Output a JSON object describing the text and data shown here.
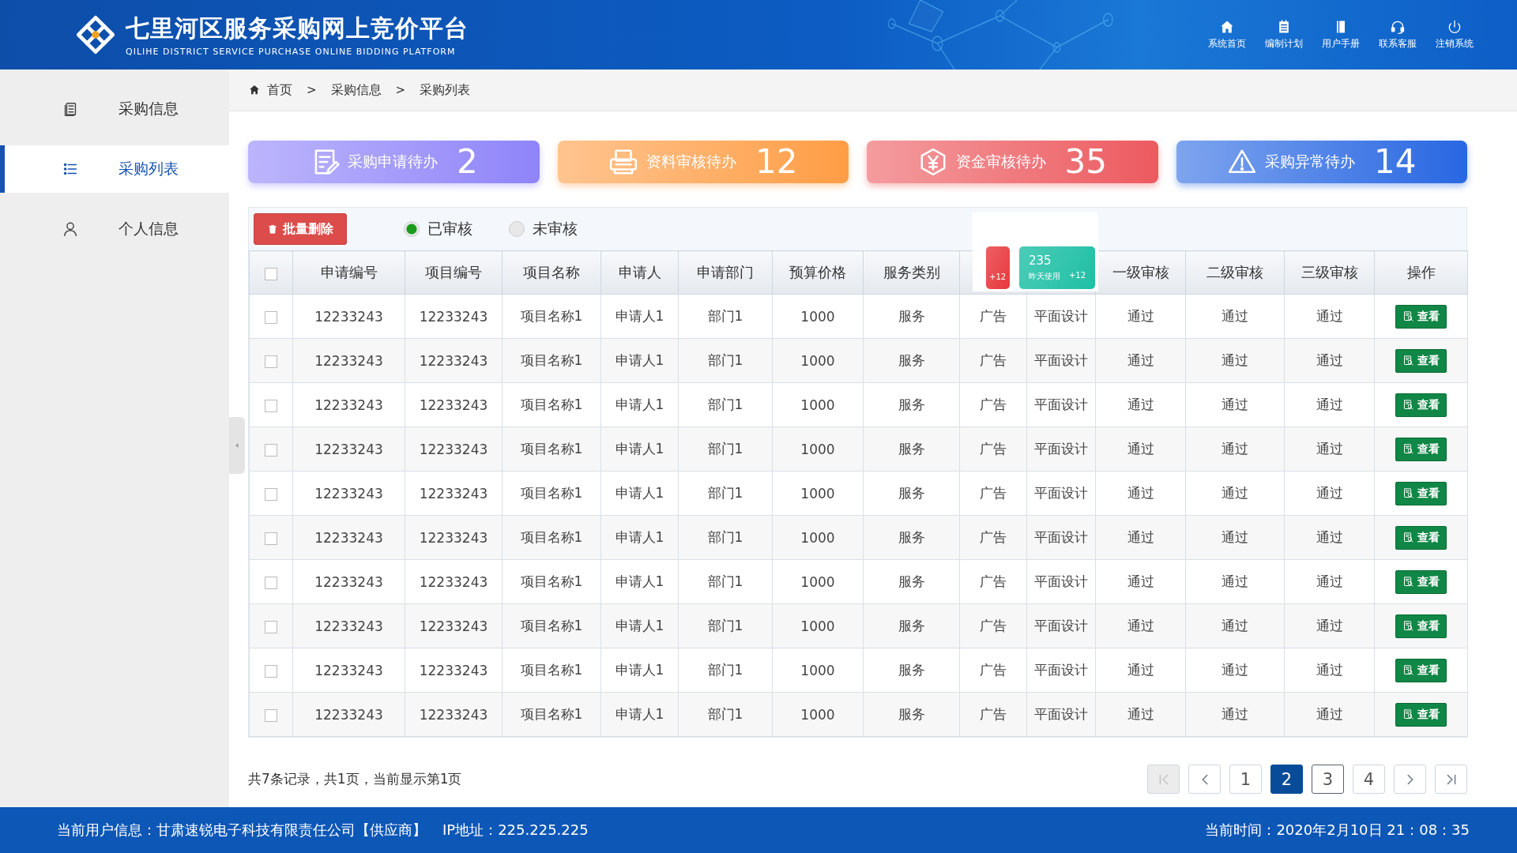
{
  "header": {
    "title": "七里河区服务采购网上竞价平台",
    "subtitle": "QILIHE DISTRICT SERVICE PURCHASE ONLINE BIDDING PLATFORM",
    "nav": [
      {
        "label": "系统首页",
        "kind": "home"
      },
      {
        "label": "编制计划",
        "kind": "plan"
      },
      {
        "label": "用户手册",
        "kind": "book"
      },
      {
        "label": "联系客服",
        "kind": "headset"
      },
      {
        "label": "注销系统",
        "kind": "power"
      }
    ]
  },
  "sidebar": {
    "items": [
      {
        "label": "采购信息",
        "kind": "doc",
        "selected": false
      },
      {
        "label": "采购列表",
        "kind": "list",
        "selected": true
      },
      {
        "label": "个人信息",
        "kind": "user",
        "selected": false
      }
    ]
  },
  "breadcrumb": [
    "首页",
    "采购信息",
    "采购列表"
  ],
  "breadcrumb_separator": ">",
  "stats": [
    {
      "label": "采购申请待办",
      "value": "2",
      "kind": "form",
      "color": "#8f84f9"
    },
    {
      "label": "资料审核待办",
      "value": "12",
      "kind": "printer",
      "color": "#ff9d45"
    },
    {
      "label": "资金审核待办",
      "value": "35",
      "kind": "yen",
      "color": "#ec5a5f"
    },
    {
      "label": "采购异常待办",
      "value": "14",
      "kind": "warning",
      "color": "#2867e2"
    }
  ],
  "toolbar": {
    "delete_button": "批量删除",
    "filters": [
      {
        "label": "已审核",
        "selected": true
      },
      {
        "label": "未审核",
        "selected": false
      }
    ]
  },
  "popup": {
    "cards": [
      {
        "delta": "+12",
        "color": "#e8383d"
      },
      {
        "value": "235",
        "note": "昨天使用",
        "delta": "+12",
        "color": "#1fbfa5"
      }
    ]
  },
  "table": {
    "select_all_checked": false,
    "columns_left": [
      "申请编号",
      "项目编号",
      "项目名称",
      "申请人",
      "申请部门",
      "预算价格",
      "服务类别"
    ],
    "columns_right": [
      "一级审核",
      "二级审核",
      "三级审核",
      "操作"
    ],
    "rows": [
      {
        "checked": false,
        "cells": [
          "12233243",
          "12233243",
          "项目名称1",
          "申请人1",
          "部门1",
          "1000",
          "服务",
          "广告",
          "平面设计",
          "通过",
          "通过",
          "通过"
        ],
        "action": "查看"
      },
      {
        "checked": false,
        "cells": [
          "12233243",
          "12233243",
          "项目名称1",
          "申请人1",
          "部门1",
          "1000",
          "服务",
          "广告",
          "平面设计",
          "通过",
          "通过",
          "通过"
        ],
        "action": "查看"
      },
      {
        "checked": false,
        "cells": [
          "12233243",
          "12233243",
          "项目名称1",
          "申请人1",
          "部门1",
          "1000",
          "服务",
          "广告",
          "平面设计",
          "通过",
          "通过",
          "通过"
        ],
        "action": "查看"
      },
      {
        "checked": false,
        "cells": [
          "12233243",
          "12233243",
          "项目名称1",
          "申请人1",
          "部门1",
          "1000",
          "服务",
          "广告",
          "平面设计",
          "通过",
          "通过",
          "通过"
        ],
        "action": "查看"
      },
      {
        "checked": false,
        "cells": [
          "12233243",
          "12233243",
          "项目名称1",
          "申请人1",
          "部门1",
          "1000",
          "服务",
          "广告",
          "平面设计",
          "通过",
          "通过",
          "通过"
        ],
        "action": "查看"
      },
      {
        "checked": false,
        "cells": [
          "12233243",
          "12233243",
          "项目名称1",
          "申请人1",
          "部门1",
          "1000",
          "服务",
          "广告",
          "平面设计",
          "通过",
          "通过",
          "通过"
        ],
        "action": "查看"
      },
      {
        "checked": false,
        "cells": [
          "12233243",
          "12233243",
          "项目名称1",
          "申请人1",
          "部门1",
          "1000",
          "服务",
          "广告",
          "平面设计",
          "通过",
          "通过",
          "通过"
        ],
        "action": "查看"
      },
      {
        "checked": false,
        "cells": [
          "12233243",
          "12233243",
          "项目名称1",
          "申请人1",
          "部门1",
          "1000",
          "服务",
          "广告",
          "平面设计",
          "通过",
          "通过",
          "通过"
        ],
        "action": "查看"
      },
      {
        "checked": false,
        "cells": [
          "12233243",
          "12233243",
          "项目名称1",
          "申请人1",
          "部门1",
          "1000",
          "服务",
          "广告",
          "平面设计",
          "通过",
          "通过",
          "通过"
        ],
        "action": "查看"
      },
      {
        "checked": false,
        "cells": [
          "12233243",
          "12233243",
          "项目名称1",
          "申请人1",
          "部门1",
          "1000",
          "服务",
          "广告",
          "平面设计",
          "通过",
          "通过",
          "通过"
        ],
        "action": "查看"
      }
    ]
  },
  "pagination": {
    "summary": "共7条记录，共1页，当前显示第1页",
    "items": [
      {
        "kind": "first",
        "disabled": true,
        "selected": false,
        "hovered": false
      },
      {
        "kind": "prev",
        "disabled": false,
        "selected": false,
        "hovered": false
      },
      {
        "kind": "page",
        "label": "1",
        "disabled": false,
        "selected": false,
        "hovered": false
      },
      {
        "kind": "page",
        "label": "2",
        "disabled": false,
        "selected": true,
        "hovered": false
      },
      {
        "kind": "page",
        "label": "3",
        "disabled": false,
        "selected": false,
        "hovered": true
      },
      {
        "kind": "page",
        "label": "4",
        "disabled": false,
        "selected": false,
        "hovered": false
      },
      {
        "kind": "next",
        "disabled": false,
        "selected": false,
        "hovered": false
      },
      {
        "kind": "last",
        "disabled": false,
        "selected": false,
        "hovered": false
      }
    ]
  },
  "status_bar": {
    "user": "当前用户信息：甘肃速锐电子科技有限责任公司【供应商】",
    "ip": "IP地址：225.225.225",
    "time": "当前时间：2020年2月10日 21：08：35"
  }
}
